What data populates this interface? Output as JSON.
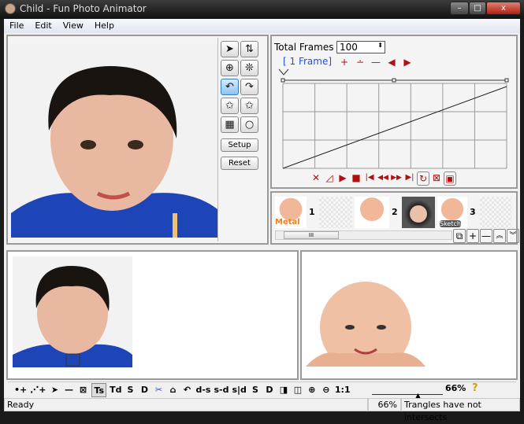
{
  "window": {
    "title": "Child - Fun Photo Animator",
    "minimize": "–",
    "maximize": "□",
    "close": "x"
  },
  "menu": [
    "File",
    "Edit",
    "View",
    "Help"
  ],
  "tools": {
    "setup": "Setup",
    "reset": "Reset"
  },
  "timeline": {
    "total_frames_label": "Total Frames",
    "total_frames_value": "100",
    "frame_label": "[ 1 Frame]",
    "frame_controls": [
      "+",
      "∸",
      "—",
      "◀",
      "▶"
    ]
  },
  "curve": {
    "type": "line",
    "x": [
      0,
      1
    ],
    "y": [
      0,
      1
    ]
  },
  "playback": [
    "✕",
    "◿",
    "▶",
    "■",
    "|◀",
    "◀◀",
    "▶▶",
    "▶|",
    "↻",
    "⊠",
    "▣"
  ],
  "thumbnails": [
    {
      "number": "1",
      "caption": "Metal"
    },
    {
      "number": "2",
      "caption": ""
    },
    {
      "number": "3",
      "caption": "Sketch"
    }
  ],
  "thumb_controls": [
    "⧉",
    "+",
    "—",
    "︽",
    "︾"
  ],
  "toolbar": {
    "items": [
      "•+",
      "⋰+",
      "➤",
      "—",
      "⊠",
      "Ts",
      "Td",
      "S",
      "D",
      "✂",
      "⌂",
      "↶",
      "d-s",
      "s-d",
      "s|d",
      "S",
      "D",
      "◨",
      "◫",
      "⊕",
      "⊖",
      "1:1"
    ],
    "zoom_text": "66%",
    "help": "?",
    "zoom_level": 66
  },
  "status": {
    "left": "Ready",
    "zoom": "66%",
    "message": "Trangles have not intersects"
  },
  "colors": {
    "accent": "#b01010",
    "link": "#2050e0"
  }
}
